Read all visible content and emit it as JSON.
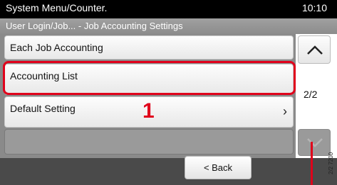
{
  "header": {
    "title": "System Menu/Counter.",
    "time": "10:10"
  },
  "breadcrumb": "User Login/Job... - Job Accounting Settings",
  "list": {
    "items": [
      {
        "label": "Each Job Accounting"
      },
      {
        "label": "Accounting List"
      },
      {
        "label": "Default Setting"
      },
      {
        "label": ""
      }
    ]
  },
  "scroll": {
    "page_indicator": "2/2",
    "up_icon": "chevron-up-icon",
    "down_icon": "chevron-down-icon"
  },
  "footer": {
    "back_label": "< Back"
  },
  "annotation": {
    "step_number": "1",
    "highlight_color": "#e0001b",
    "code": "2/2 7200"
  }
}
